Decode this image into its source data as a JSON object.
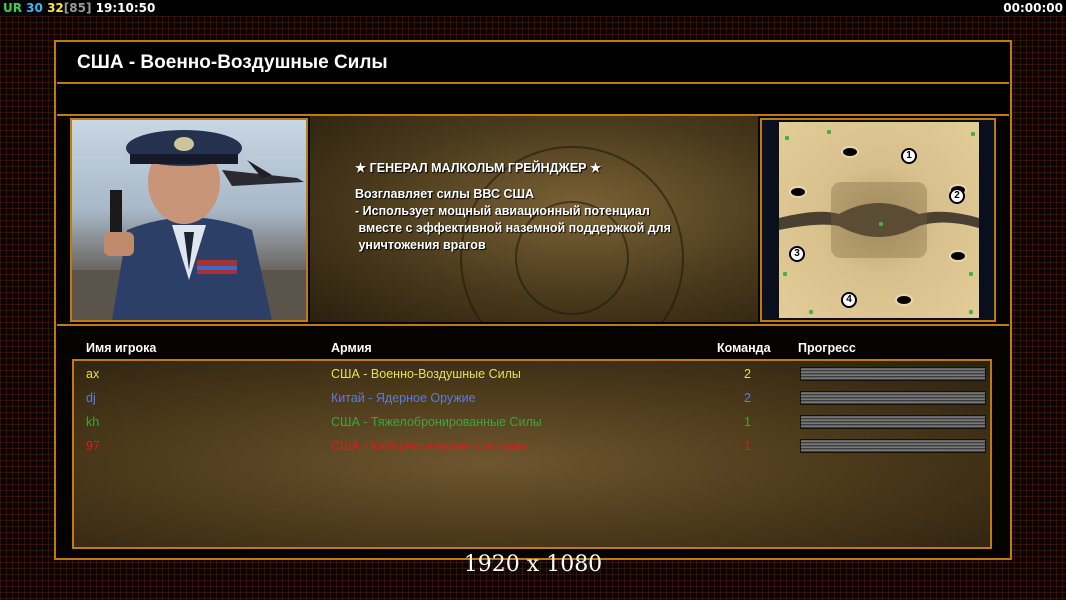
{
  "hud": {
    "tag": "UR",
    "fps_a": "30",
    "fps_b": "32",
    "fps_c": "[85]",
    "clock": "19:10:50",
    "timer": "00:00:00"
  },
  "title": "США - Военно-Воздушные Силы",
  "general": {
    "name": "★ ГЕНЕРАЛ МАЛКОЛЬМ ГРЕЙНДЖЕР ★",
    "lines": [
      "Возглавляет силы ВВС США",
      "- Использует мощный авиационный потенциал",
      " вместе с эффективной наземной поддержкой для",
      " уничтожения врагов"
    ]
  },
  "minimap": {
    "start_numbers": [
      "1",
      "2",
      "3",
      "4"
    ]
  },
  "table": {
    "headers": {
      "player": "Имя игрока",
      "army": "Армия",
      "team": "Команда",
      "progress": "Прогресс"
    },
    "rows": [
      {
        "name": "ax",
        "army": "США - Военно-Воздушные Силы",
        "team": "2",
        "color": "#e8e050"
      },
      {
        "name": "dj",
        "army": "Китай - Ядерное Оружие",
        "team": "2",
        "color": "#5a7ae8"
      },
      {
        "name": "kh",
        "army": "США - Тяжелобронированные Силы",
        "team": "1",
        "color": "#3aa83a"
      },
      {
        "name": "97",
        "army": "США - Кибернетические Системы",
        "team": "1",
        "color": "#e01a1a"
      }
    ]
  },
  "colors": {
    "frame": "#c07a10",
    "hud_tag": "#39d24a",
    "hud_fps_a": "#39b8ff",
    "hud_fps_b": "#ffe23a",
    "hud_fps_c": "#9a9a9a"
  },
  "resolution": "1920 x 1080"
}
